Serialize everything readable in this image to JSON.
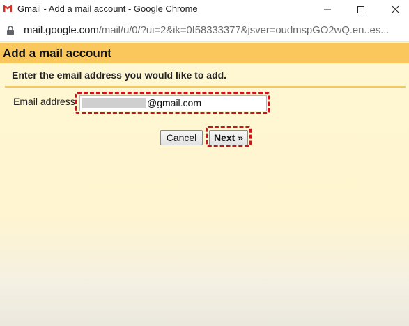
{
  "window": {
    "title": "Gmail - Add a mail account - Google Chrome",
    "minimize_icon": "minimize-icon",
    "maximize_icon": "maximize-icon",
    "close_icon": "close-icon"
  },
  "addressbar": {
    "lock_icon": "lock-icon",
    "url_domain": "mail.google.com",
    "url_path": "/mail/u/0/?ui=2&ik=0f58333377&jsver=oudmspGO2wQ.en..es..."
  },
  "page": {
    "title": "Add a mail account",
    "instructions": "Enter the email address you would like to add.",
    "email_label": "Email address",
    "email_value_suffix": "@gmail.com",
    "cancel_label": "Cancel",
    "next_label": "Next »"
  },
  "colors": {
    "header_bg": "#f9c75c",
    "page_bg": "#fff7d3",
    "divider": "#f3c761",
    "highlight": "#c4161c",
    "gmail_red": "#d93025"
  }
}
